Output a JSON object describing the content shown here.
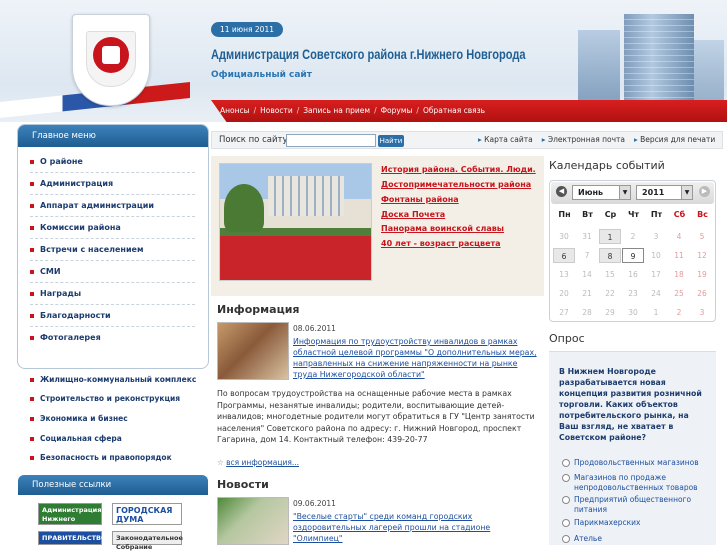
{
  "header": {
    "date": "11 июня 2011",
    "title": "Администрация Советского района г.Нижнего Новгорода",
    "subtitle": "Официальный сайт",
    "nav": [
      "Анонсы",
      "Новости",
      "Запись на прием",
      "Форумы",
      "Обратная связь"
    ]
  },
  "search": {
    "label": "Поиск по сайту:",
    "value": "",
    "button": "Найти"
  },
  "toplinks": [
    "Карта сайта",
    "Электронная почта",
    "Версия для печати"
  ],
  "sidebar": {
    "title": "Главное меню",
    "items": [
      "О районе",
      "Администрация",
      "Аппарат администрации",
      "Комиссии района",
      "Встречи с населением",
      "СМИ",
      "Награды",
      "Благодарности",
      "Фотогалерея"
    ],
    "extra_items": [
      "Жилищно-коммунальный комплекс",
      "Строительство и реконструкция",
      "Экономика и бизнес",
      "Социальная сфера",
      "Безопасность и правопорядок"
    ],
    "links_title": "Полезные ссылки",
    "banners": [
      "Администрация Нижнего Новгорода",
      "ГОРОДСКАЯ ДУМА",
      "ПРАВИТЕЛЬСТВО",
      "Законодательное Собрание"
    ]
  },
  "feature": {
    "links": [
      "История района. События. Люди.",
      "Достопримечательности района",
      "Фонтаны района",
      "Доска Почета",
      "Панорама воинской славы",
      "40 лет - возраст расцвета"
    ]
  },
  "info": {
    "title": "Информация",
    "date": "08.06.2011",
    "link": "Информация по трудоустройству инвалидов в рамках областной целевой программы \"О дополнительных мерах, направленных на снижение напряженности на рынке труда Нижегородской области\"",
    "body": "По вопросам трудоустройства на оснащенные рабочие места в рамках Программы, незанятые инвалиды; родители, воспитывающие детей-инвалидов; многодетные родители могут обратиться в ГУ \"Центр занятости населения\" Советского района по адресу: г. Нижний Новгород, проспект Гагарина, дом 14. Контактный телефон: 439-20-77",
    "more": "вся информация..."
  },
  "news": {
    "title": "Новости",
    "date": "09.06.2011",
    "link": "\"Веселые старты\" среди команд городских оздоровительных лагерей прошли на стадионе \"Олимпиец\""
  },
  "calendar": {
    "title": "Календарь событий",
    "month": "Июнь",
    "year": "2011",
    "dow": [
      "Пн",
      "Вт",
      "Ср",
      "Чт",
      "Пт",
      "Сб",
      "Вс"
    ],
    "weeks": [
      [
        "30",
        "31",
        "1",
        "2",
        "3",
        "4",
        "5"
      ],
      [
        "6",
        "7",
        "8",
        "9",
        "10",
        "11",
        "12"
      ],
      [
        "13",
        "14",
        "15",
        "16",
        "17",
        "18",
        "19"
      ],
      [
        "20",
        "21",
        "22",
        "23",
        "24",
        "25",
        "26"
      ],
      [
        "27",
        "28",
        "29",
        "30",
        "1",
        "2",
        "3"
      ]
    ]
  },
  "poll": {
    "title": "Опрос",
    "question": "В Нижнем Новгороде разрабатывается новая концепция развития розничной торговли. Каких объектов потребительского рынка, на Ваш взгляд, не хватает в Советском районе?",
    "options": [
      "Продовольственных магазинов",
      "Магазинов по продаже непродовольственных товаров",
      "Предприятий общественного питания",
      "Парикмахерских",
      "Ателье"
    ]
  }
}
